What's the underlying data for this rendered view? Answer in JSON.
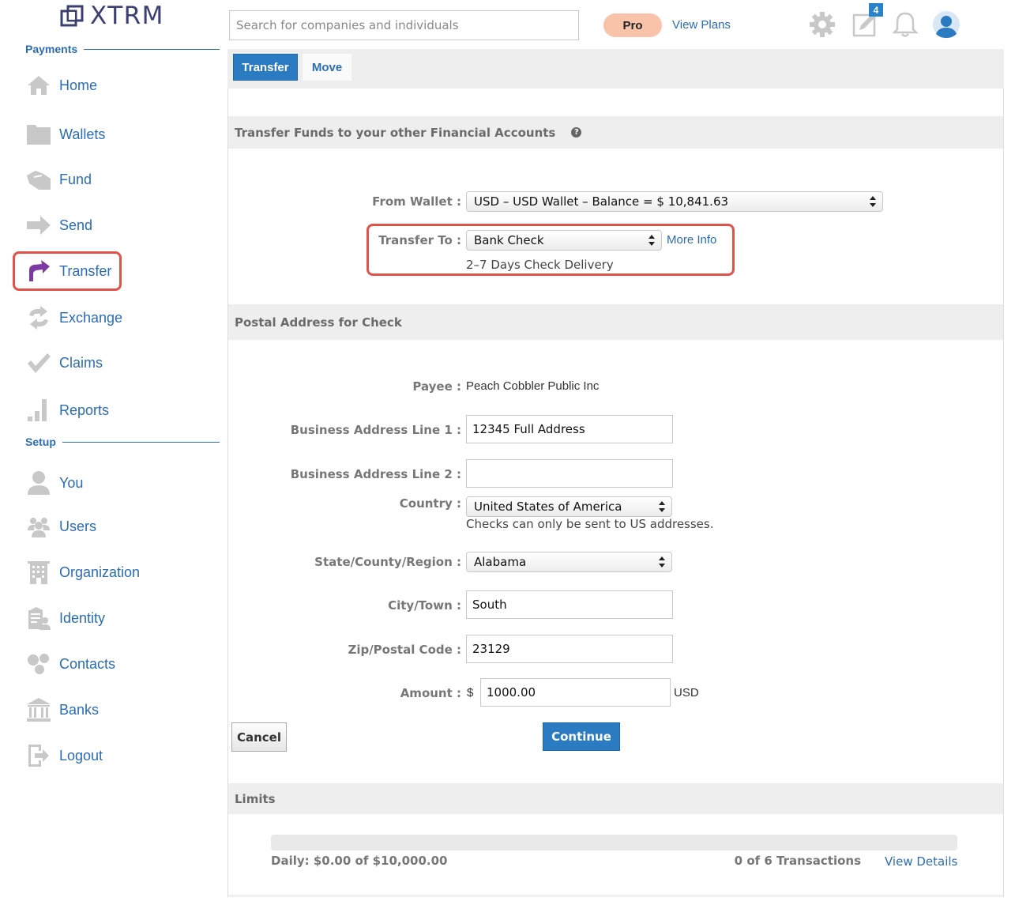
{
  "brand": {
    "name": "XTRM"
  },
  "sidebar": {
    "payments_heading": "Payments",
    "setup_heading": "Setup",
    "payments_items": [
      {
        "label": "Home",
        "icon": "home-icon"
      },
      {
        "label": "Wallets",
        "icon": "folder-icon"
      },
      {
        "label": "Fund",
        "icon": "fund-icon"
      },
      {
        "label": "Send",
        "icon": "send-arrow-icon"
      },
      {
        "label": "Transfer",
        "icon": "transfer-arrow-icon",
        "active": true
      },
      {
        "label": "Exchange",
        "icon": "exchange-icon"
      },
      {
        "label": "Claims",
        "icon": "checkmark-icon"
      },
      {
        "label": "Reports",
        "icon": "bar-chart-icon"
      }
    ],
    "setup_items": [
      {
        "label": "You",
        "icon": "person-icon"
      },
      {
        "label": "Users",
        "icon": "users-icon"
      },
      {
        "label": "Organization",
        "icon": "building-icon"
      },
      {
        "label": "Identity",
        "icon": "identity-icon"
      },
      {
        "label": "Contacts",
        "icon": "contacts-icon"
      },
      {
        "label": "Banks",
        "icon": "bank-icon"
      },
      {
        "label": "Logout",
        "icon": "logout-icon"
      }
    ]
  },
  "header": {
    "search_placeholder": "Search for companies and individuals",
    "pro_label": "Pro",
    "view_plans": "View Plans",
    "notifications_badge": "4"
  },
  "tabs": [
    {
      "label": "Transfer",
      "active": true
    },
    {
      "label": "Move",
      "active": false
    }
  ],
  "transfer_section": {
    "title": "Transfer Funds to your other Financial Accounts",
    "from_wallet_label": "From Wallet :",
    "from_wallet_value": "USD – USD Wallet – Balance = $ 10,841.63",
    "transfer_to_label": "Transfer To :",
    "transfer_to_value": "Bank Check",
    "more_info": "More Info",
    "delivery_note": "2–7 Days Check Delivery"
  },
  "address_section": {
    "title": "Postal Address for Check",
    "payee_label": "Payee :",
    "payee_value": "Peach Cobbler Public Inc",
    "address1_label": "Business Address Line 1 :",
    "address1_value": "12345 Full Address",
    "address2_label": "Business Address Line 2 :",
    "address2_value": "",
    "country_label": "Country :",
    "country_value": "United States of America",
    "country_note": "Checks can only be sent to US addresses.",
    "state_label": "State/County/Region :",
    "state_value": "Alabama",
    "city_label": "City/Town :",
    "city_value": "South",
    "zip_label": "Zip/Postal Code :",
    "zip_value": "23129",
    "amount_label": "Amount :",
    "amount_currency_symbol": "$",
    "amount_value": "1000.00",
    "amount_currency": "USD"
  },
  "actions": {
    "cancel": "Cancel",
    "continue": "Continue"
  },
  "limits_section": {
    "title": "Limits",
    "daily_text": "Daily: $0.00 of $10,000.00",
    "daily_used_fraction": 0,
    "transactions_text": "0 of 6 Transactions",
    "view_details": "View Details"
  },
  "colors": {
    "accent": "#2a7bc1",
    "link": "#2a6db3",
    "highlight": "#e0524a",
    "pro_pill": "#f8c3a9",
    "transfer_icon": "#7b3aa3"
  }
}
